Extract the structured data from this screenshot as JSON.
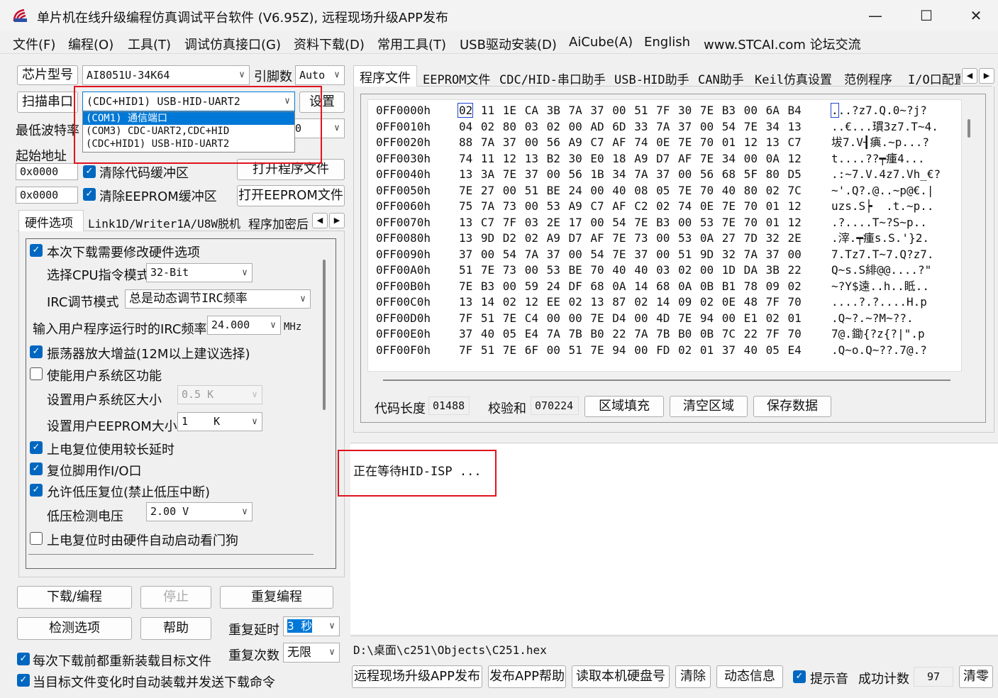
{
  "window": {
    "title": "单片机在线升级编程仿真调试平台软件 (V6.95Z), 远程现场升级APP发布",
    "minimize": "—",
    "maximize": "☐",
    "close": "✕"
  },
  "menu": [
    "文件(F)",
    "编程(O)",
    "工具(T)",
    "调试仿真接口(G)",
    "资料下载(D)",
    "常用工具(T)",
    "USB驱动安装(D)",
    "AiCube(A)",
    "English",
    "www.STCAI.com 论坛交流"
  ],
  "left": {
    "chip_label": "芯片型号",
    "chip_value": "AI8051U-34K64",
    "pins_label": "引脚数",
    "pins_value": "Auto",
    "scan_button": "扫描串口",
    "port_value": "(CDC+HID1) USB-HID-UART2",
    "settings_button": "设置",
    "port_options": [
      "(COM1) 通信端口",
      "(COM3) CDC-UART2,CDC+HID",
      "(CDC+HID1) USB-HID-UART2"
    ],
    "baud_label": "最低波特率",
    "baud_value_partial": "0",
    "start_addr_label": "起始地址",
    "addr1": "0x0000",
    "clear_code": "清除代码缓冲区",
    "open_program": "打开程序文件",
    "addr2": "0x0000",
    "clear_eeprom": "清除EEPROM缓冲区",
    "open_eeprom": "打开EEPROM文件"
  },
  "hw_tabs": [
    "硬件选项",
    "Link1D/Writer1A/U8W脱机",
    "程序加密后"
  ],
  "hw": {
    "modify_hw": "本次下载需要修改硬件选项",
    "cpu_mode_label": "选择CPU指令模式",
    "cpu_mode_value": "32-Bit",
    "irc_mode_label": "IRC调节模式",
    "irc_mode_value": "总是动态调节IRC频率",
    "irc_freq_label": "输入用户程序运行时的IRC频率",
    "irc_freq_value": "24.000",
    "irc_freq_unit": "MHz",
    "osc_gain": "振荡器放大增益(12M以上建议选择)",
    "user_sys_area": "使能用户系统区功能",
    "sys_size_label": "设置用户系统区大小",
    "sys_size_value": "0.5 K",
    "eeprom_size_label": "设置用户EEPROM大小",
    "eeprom_size_value": "1    K",
    "long_reset": "上电复位使用较长延时",
    "reset_io": "复位脚用作I/O口",
    "lvr": "允许低压复位(禁止低压中断)",
    "lvd_label": "低压检测电压",
    "lvd_value": "2.00 V",
    "watchdog": "上电复位时由硬件自动启动看门狗"
  },
  "actions": {
    "download": "下载/编程",
    "stop": "停止",
    "reprogram": "重复编程",
    "check": "检测选项",
    "help": "帮助",
    "repeat_delay_label": "重复延时",
    "repeat_delay_value": "3 秒",
    "repeat_count_label": "重复次数",
    "repeat_count_value": "无限",
    "reload_each": "每次下载前都重新装载目标文件",
    "auto_reload": "当目标文件变化时自动装载并发送下载命令"
  },
  "right_tabs": [
    "程序文件",
    "EEPROM文件",
    "CDC/HID-串口助手",
    "USB-HID助手",
    "CAN助手",
    "Keil仿真设置",
    "范例程序",
    "I/O口配置"
  ],
  "hex": {
    "rows": [
      {
        "addr": "0FF0000h",
        "bytes": "02 11 1E CA 3B 7A 37 00 51 7F 30 7E B3 00 6A B4",
        "ascii": "...?z7.Q.0~?j?"
      },
      {
        "addr": "0FF0010h",
        "bytes": "04 02 80 03 02 00 AD 6D 33 7A 37 00 54 7E 34 13",
        "ascii": "..€...瑻3z7.T~4."
      },
      {
        "addr": "0FF0020h",
        "bytes": "88 7A 37 00 56 A9 C7 AF 74 0E 7E 70 01 12 13 C7",
        "ascii": "坺7.V┨痶.~p...?"
      },
      {
        "addr": "0FF0030h",
        "bytes": "74 11 12 13 B2 30 E0 18 A9 D7 AF 7E 34 00 0A 12",
        "ascii": "t....??┯瘇4..."
      },
      {
        "addr": "0FF0040h",
        "bytes": "13 3A 7E 37 00 56 1B 34 7A 37 00 56 68 5F 80 D5",
        "ascii": ".:~7.V.4z7.Vh_€?"
      },
      {
        "addr": "0FF0050h",
        "bytes": "7E 27 00 51 BE 24 00 40 08 05 7E 70 40 80 02 7C",
        "ascii": "~'.Q?.@..~p@€.|"
      },
      {
        "addr": "0FF0060h",
        "bytes": "75 7A 73 00 53 A9 C7 AF C2 02 74 0E 7E 70 01 12",
        "ascii": "uzs.S┝  .t.~p.."
      },
      {
        "addr": "0FF0070h",
        "bytes": "13 C7 7F 03 2E 17 00 54 7E B3 00 53 7E 70 01 12",
        "ascii": ".?....T~?S~p.."
      },
      {
        "addr": "0FF0080h",
        "bytes": "13 9D D2 02 A9 D7 AF 7E 73 00 53 0A 27 7D 32 2E",
        "ascii": ".滓.┯瘇s.S.'}2."
      },
      {
        "addr": "0FF0090h",
        "bytes": "37 00 54 7A 37 00 54 7E 37 00 51 9D 32 7A 37 00",
        "ascii": "7.Tz7.T~7.Q?z7."
      },
      {
        "addr": "0FF00A0h",
        "bytes": "51 7E 73 00 53 BE 70 40 40 03 02 00 1D DA 3B 22",
        "ascii": "Q~s.S緋@@....?\""
      },
      {
        "addr": "0FF00B0h",
        "bytes": "7E B3 00 59 24 DF 68 0A 14 68 0A 0B B1 78 09 02",
        "ascii": "~?Y$遠..h..眡.."
      },
      {
        "addr": "0FF00C0h",
        "bytes": "13 14 02 12 EE 02 13 87 02 14 09 02 0E 48 7F 70",
        "ascii": "....?.?....H.p"
      },
      {
        "addr": "0FF00D0h",
        "bytes": "7F 51 7E C4 00 00 7E D4 00 4D 7E 94 00 E1 02 01",
        "ascii": ".Q~?.~?M~??."
      },
      {
        "addr": "0FF00E0h",
        "bytes": "37 40 05 E4 7A 7B B0 22 7A 7B B0 0B 7C 22 7F 70",
        "ascii": "7@.鋤{?z{?|\".p"
      },
      {
        "addr": "0FF00F0h",
        "bytes": "7F 51 7E 6F 00 51 7E 94 00 FD 02 01 37 40 05 E4",
        "ascii": ".Q~o.Q~??.7@.?"
      }
    ]
  },
  "code_info": {
    "length_label": "代码长度",
    "length_value": "01488",
    "checksum_label": "校验和",
    "checksum_value": "070224",
    "fill_button": "区域填充",
    "clear_button": "清空区域",
    "save_button": "保存数据"
  },
  "log": {
    "message": "正在等待HID-ISP ..."
  },
  "file_path": "D:\\桌面\\c251\\Objects\\C251.hex",
  "bottom": {
    "remote_publish": "远程现场升级APP发布",
    "publish_help": "发布APP帮助",
    "read_disk": "读取本机硬盘号",
    "clear": "清除",
    "dynamic_info": "动态信息",
    "sound_label": "提示音",
    "success_label": "成功计数",
    "success_value": "97",
    "reset_button": "清零"
  },
  "colors": {
    "accent": "#0067c0",
    "highlight_red": "#e0141e",
    "selection": "#0078d7"
  }
}
